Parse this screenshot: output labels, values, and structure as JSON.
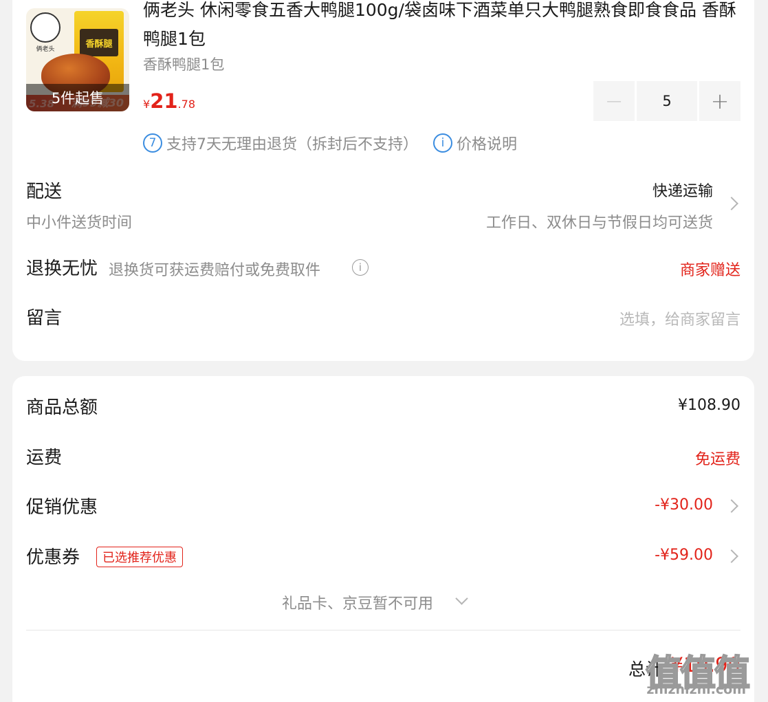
{
  "product": {
    "thumb_badge": "5件起售",
    "thumb_bag_text": "香酥腿",
    "thumb_seal_text": "俩老头",
    "thumb_strip_left": "5.38",
    "thumb_strip_right": "满99减30",
    "title": "俩老头 休闲零食五香大鸭腿100g/袋卤味下酒菜单只大鸭腿熟食即食食品 香酥鸭腿1包",
    "variant": "香酥鸭腿1包",
    "price_symbol": "¥",
    "price_int": "21",
    "price_dec": ".78",
    "quantity": "5",
    "minus": "−",
    "plus": "+",
    "return_badge": "7",
    "return_text": "支持7天无理由退货（拆封后不支持）",
    "price_info_icon": "i",
    "price_info_text": "价格说明"
  },
  "delivery": {
    "label": "配送",
    "sub": "中小件送货时间",
    "method": "快递运输",
    "schedule": "工作日、双休日与节假日均可送货"
  },
  "returns": {
    "label": "退换无忧",
    "sub": "退换货可获运费赔付或免费取件",
    "info_icon": "i",
    "right": "商家赠送"
  },
  "message": {
    "label": "留言",
    "placeholder": "选填，给商家留言"
  },
  "summary": {
    "goods_label": "商品总额",
    "goods_value": "¥108.90",
    "shipping_label": "运费",
    "shipping_value": "免运费",
    "promo_label": "促销优惠",
    "promo_value": "-¥30.00",
    "coupon_label": "优惠券",
    "coupon_tag": "已选推荐优惠",
    "coupon_value": "-¥59.00",
    "giftcard_text": "礼品卡、京豆暂不可用",
    "total_label": "总计",
    "total_value": "¥19.90"
  },
  "watermark": {
    "text": "值值值",
    "url": "zhizhizhi.com"
  },
  "colors": {
    "accent_red": "#e2231a",
    "info_blue": "#3b8de0",
    "background": "#f2f2f2"
  }
}
